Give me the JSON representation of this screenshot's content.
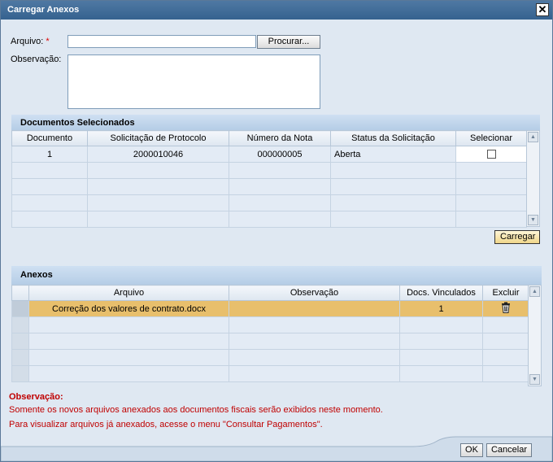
{
  "dialog": {
    "title": "Carregar Anexos",
    "close_glyph": "✕"
  },
  "form": {
    "arquivo_label": "Arquivo:",
    "required_mark": "*",
    "arquivo_value": "",
    "browse_label": "Procurar...",
    "observacao_label": "Observação:",
    "observacao_value": ""
  },
  "docs": {
    "title": "Documentos Selecionados",
    "columns": [
      "Documento",
      "Solicitação de Protocolo",
      "Número da Nota",
      "Status da Solicitação",
      "Selecionar"
    ],
    "rows": [
      {
        "documento": "1",
        "solicitacao": "2000010046",
        "numero_nota": "000000005",
        "status": "Aberta",
        "selecionado": false
      }
    ],
    "carregar_label": "Carregar"
  },
  "anexos": {
    "title": "Anexos",
    "columns": [
      "Arquivo",
      "Observação",
      "Docs. Vinculados",
      "Excluir"
    ],
    "rows": [
      {
        "arquivo": "Correção dos valores de contrato.docx",
        "observacao": "",
        "docs_vinculados": "1",
        "excluir_icon": "trash-icon"
      }
    ]
  },
  "note": {
    "title": "Observação:",
    "line1": "Somente os novos arquivos anexados aos documentos fiscais serão exibidos neste momento.",
    "line2": "Para visualizar arquivos já anexados, acesse o menu \"Consultar Pagamentos\"."
  },
  "footer": {
    "ok_label": "OK",
    "cancel_label": "Cancelar"
  },
  "colors": {
    "title_bar": "#35628f",
    "highlight_row": "#e8bf6c",
    "note_text": "#c00000"
  }
}
